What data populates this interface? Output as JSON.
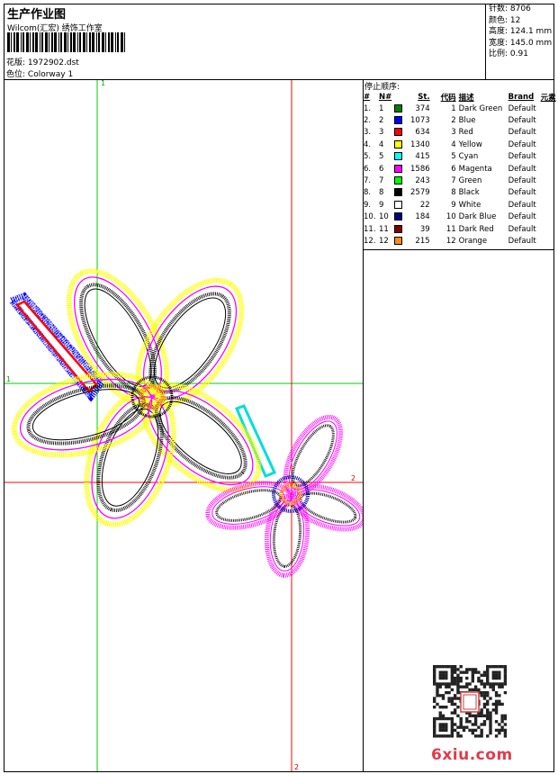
{
  "header": {
    "title": "生产作业图",
    "company": "Wilcom(汇宏) 绣饰工作室",
    "design_label": "花版:",
    "design_value": "1972902.dst",
    "colorway_label": "色位:",
    "colorway_value": "Colorway 1"
  },
  "stats": [
    {
      "label": "针数:",
      "value": "8706"
    },
    {
      "label": "颜色:",
      "value": "12"
    },
    {
      "label": "高度:",
      "value": "124.1 mm"
    },
    {
      "label": "宽度:",
      "value": "145.0 mm"
    },
    {
      "label": "比例:",
      "value": "0.91"
    }
  ],
  "stop_sequence": {
    "title": "停止顺序:",
    "columns": [
      "#",
      "N#",
      "St.",
      "代码",
      "描述",
      "Brand",
      "元素"
    ],
    "rows": [
      {
        "idx": "1.",
        "n": "1",
        "color": "#008000",
        "st": "374",
        "code": "1",
        "desc": "Dark Green",
        "brand": "Default"
      },
      {
        "idx": "2.",
        "n": "2",
        "color": "#0000ff",
        "st": "1073",
        "code": "2",
        "desc": "Blue",
        "brand": "Default"
      },
      {
        "idx": "3.",
        "n": "3",
        "color": "#ff0000",
        "st": "634",
        "code": "3",
        "desc": "Red",
        "brand": "Default"
      },
      {
        "idx": "4.",
        "n": "4",
        "color": "#ffff00",
        "st": "1340",
        "code": "4",
        "desc": "Yellow",
        "brand": "Default"
      },
      {
        "idx": "5.",
        "n": "5",
        "color": "#00ffff",
        "st": "415",
        "code": "5",
        "desc": "Cyan",
        "brand": "Default"
      },
      {
        "idx": "6.",
        "n": "6",
        "color": "#ff00ff",
        "st": "1586",
        "code": "6",
        "desc": "Magenta",
        "brand": "Default"
      },
      {
        "idx": "7.",
        "n": "7",
        "color": "#00ff00",
        "st": "243",
        "code": "7",
        "desc": "Green",
        "brand": "Default"
      },
      {
        "idx": "8.",
        "n": "8",
        "color": "#000000",
        "st": "2579",
        "code": "8",
        "desc": "Black",
        "brand": "Default"
      },
      {
        "idx": "9.",
        "n": "9",
        "color": "#ffffff",
        "st": "22",
        "code": "9",
        "desc": "White",
        "brand": "Default"
      },
      {
        "idx": "10.",
        "n": "10",
        "color": "#000080",
        "st": "184",
        "code": "10",
        "desc": "Dark Blue",
        "brand": "Default"
      },
      {
        "idx": "11.",
        "n": "11",
        "color": "#800000",
        "st": "39",
        "code": "11",
        "desc": "Dark Red",
        "brand": "Default"
      },
      {
        "idx": "12.",
        "n": "12",
        "color": "#ff8c1a",
        "st": "215",
        "code": "12",
        "desc": "Orange",
        "brand": "Default"
      }
    ]
  },
  "guides": {
    "marker_1": "1",
    "marker_2": "2",
    "vertical_green_color": "#00cc00",
    "vertical_red_color": "#ff0000"
  },
  "footer": {
    "logo_text": "6xiu.com",
    "logo_color": "#e23a4a"
  },
  "icons": {
    "barcode": "barcode-icon",
    "qr": "qr-code-icon"
  }
}
